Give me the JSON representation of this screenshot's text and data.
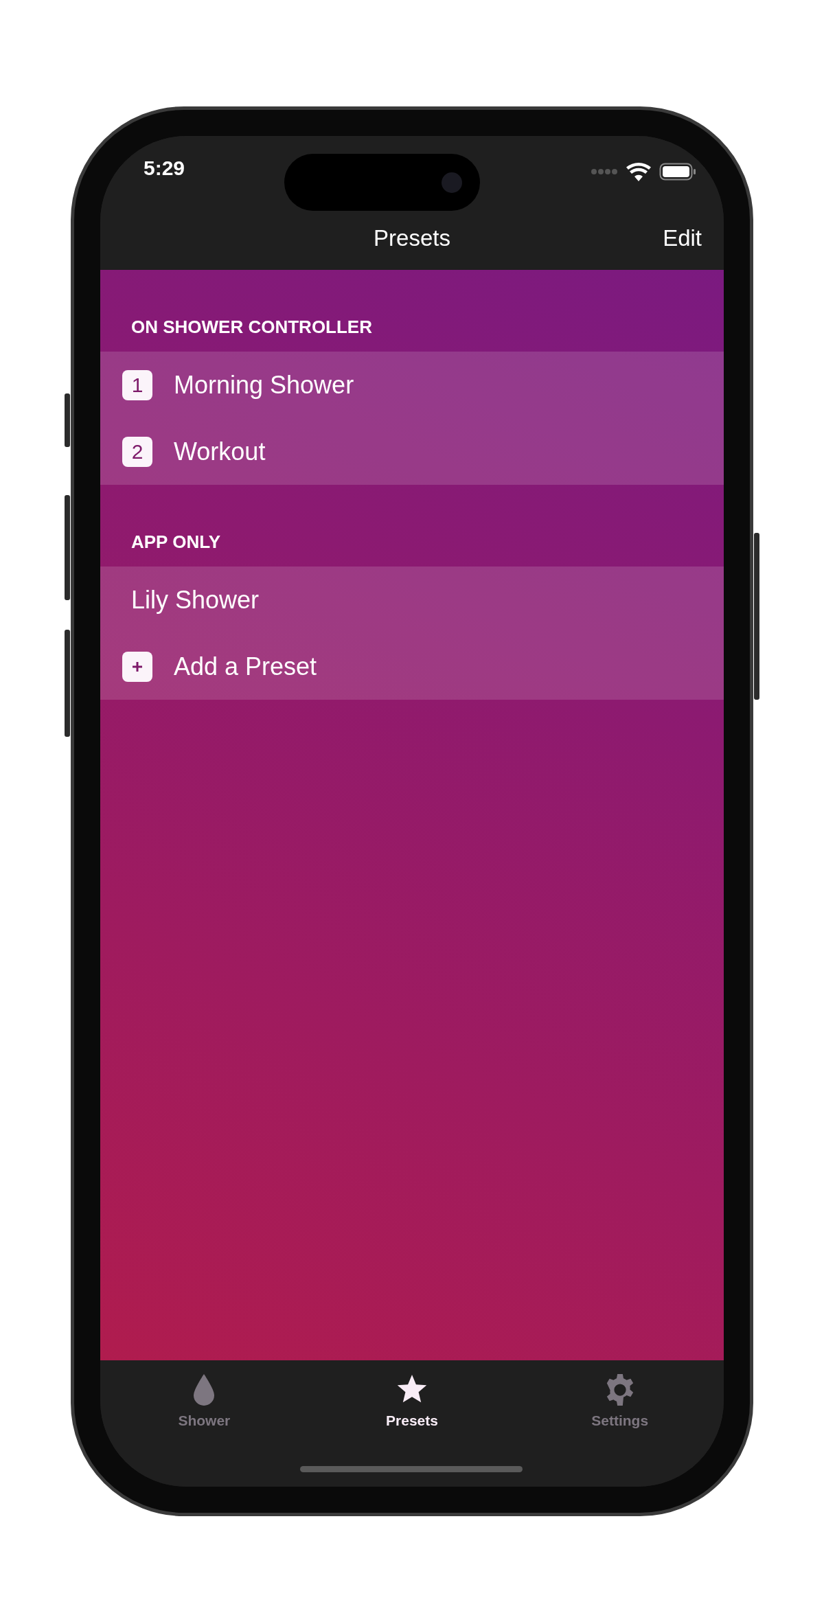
{
  "status_bar": {
    "time": "5:29"
  },
  "nav_bar": {
    "title": "Presets",
    "edit": "Edit"
  },
  "sections": [
    {
      "header": "ON SHOWER CONTROLLER",
      "rows": [
        {
          "kind": "numbered",
          "badge": "1",
          "label": "Morning Shower"
        },
        {
          "kind": "numbered",
          "badge": "2",
          "label": "Workout"
        }
      ]
    },
    {
      "header": "APP ONLY",
      "rows": [
        {
          "kind": "plain",
          "label": "Lily Shower"
        },
        {
          "kind": "add",
          "label": "Add a Preset"
        }
      ]
    }
  ],
  "tab_bar": [
    {
      "label": "Shower",
      "selected": false
    },
    {
      "label": "Presets",
      "selected": true
    },
    {
      "label": "Settings",
      "selected": false
    }
  ]
}
